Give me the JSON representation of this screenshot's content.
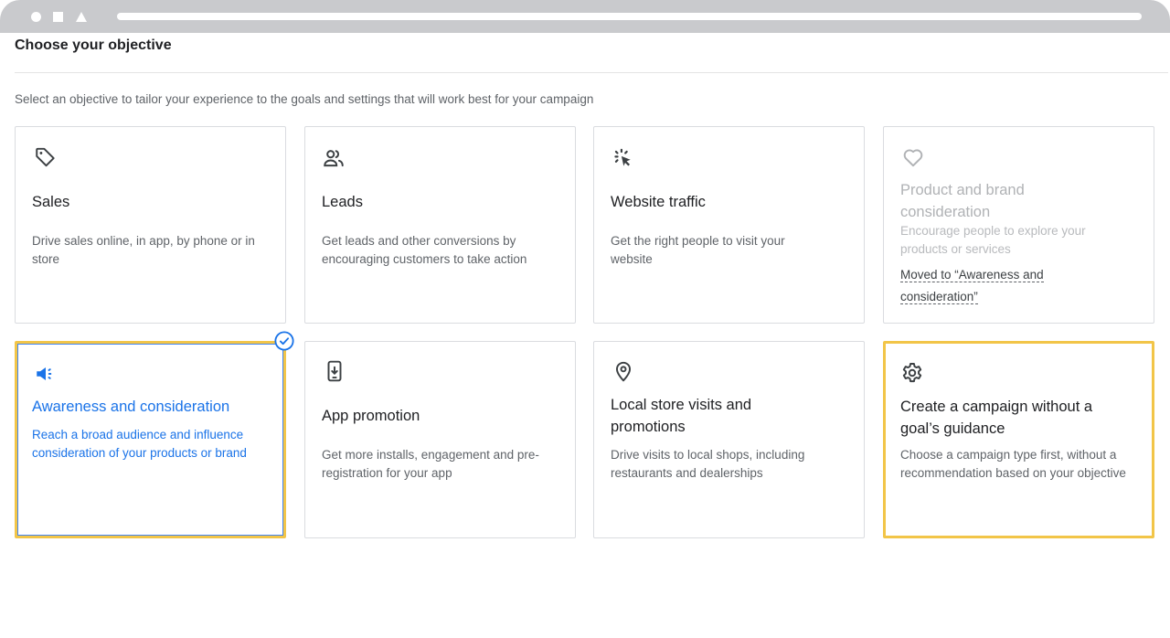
{
  "page": {
    "title": "Choose your objective",
    "subtitle": "Select an objective to tailor your experience to the goals and settings that will work best for your campaign"
  },
  "cards": {
    "sales": {
      "icon": "tag-icon",
      "title": "Sales",
      "desc": "Drive sales online, in app, by phone or in store"
    },
    "leads": {
      "icon": "people-icon",
      "title": "Leads",
      "desc": "Get leads and other conversions by encouraging customers to take action"
    },
    "website_traffic": {
      "icon": "cursor-click-icon",
      "title": "Website traffic",
      "desc": "Get the right people to visit your website"
    },
    "product_brand": {
      "icon": "heart-icon",
      "title": "Product and brand consideration",
      "desc": "Encourage people to explore your products or services",
      "note": "Moved to “Awareness and consideration”",
      "state": "disabled"
    },
    "awareness": {
      "icon": "megaphone-icon",
      "title": "Awareness and consideration",
      "desc": "Reach a broad audience and influence consideration of your products or brand",
      "state": "selected"
    },
    "app_promotion": {
      "icon": "phone-download-icon",
      "title": "App promotion",
      "desc": "Get more installs, engagement and pre-registration for your app"
    },
    "local_store": {
      "icon": "location-pin-icon",
      "title": "Local store visits and promotions",
      "desc": "Drive visits to local shops, including restaurants and dealerships"
    },
    "no_goal": {
      "icon": "gear-icon",
      "title": "Create a campaign without a goal’s guidance",
      "desc": "Choose a campaign type first, without a recommendation based on your objective",
      "state": "highlighted"
    }
  },
  "colors": {
    "selected_accent": "#1a73e8",
    "highlight_border": "#f2c548",
    "browser_chrome": "#c9cacd"
  }
}
